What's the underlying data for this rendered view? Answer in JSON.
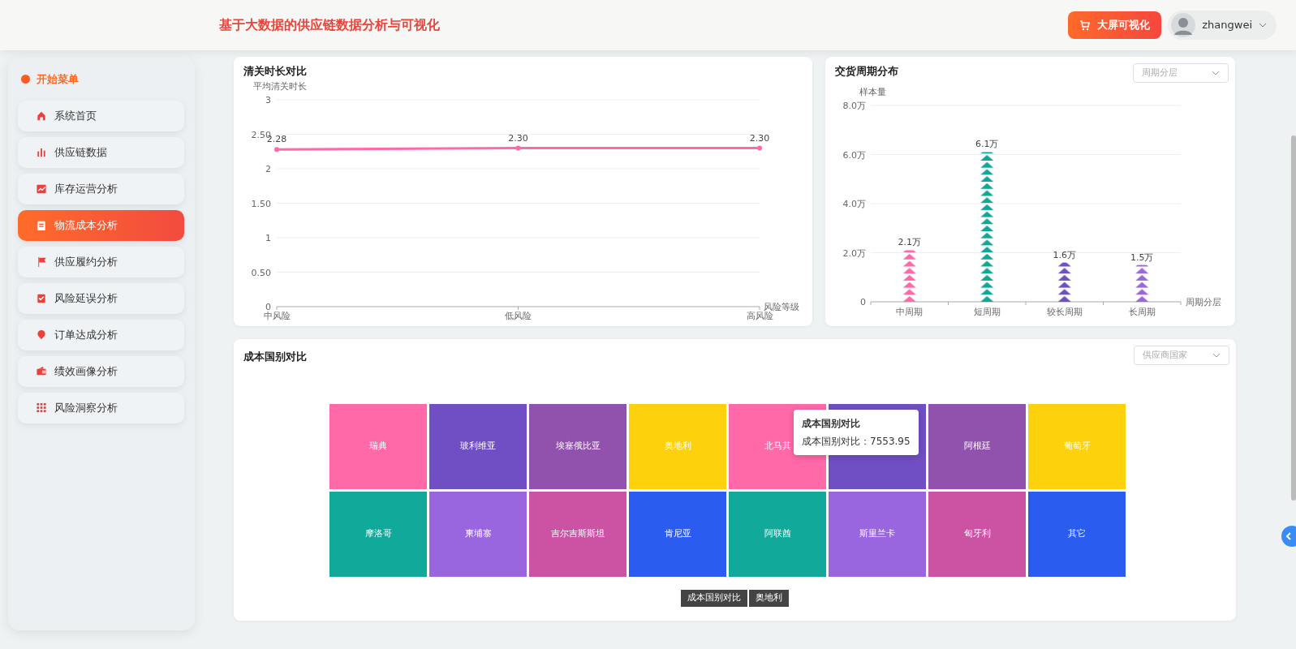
{
  "header": {
    "title": "基于大数据的供应链数据分析与可视化",
    "screen_button": "大屏可视化",
    "user": "zhangwei"
  },
  "sidebar": {
    "heading": "开始菜单",
    "items": [
      {
        "label": "系统首页",
        "selected": false
      },
      {
        "label": "供应链数据",
        "selected": false
      },
      {
        "label": "库存运营分析",
        "selected": false
      },
      {
        "label": "物流成本分析",
        "selected": true
      },
      {
        "label": "供应履约分析",
        "selected": false
      },
      {
        "label": "风险延误分析",
        "selected": false
      },
      {
        "label": "订单达成分析",
        "selected": false
      },
      {
        "label": "绩效画像分析",
        "selected": false
      },
      {
        "label": "风险洞察分析",
        "selected": false
      }
    ]
  },
  "clearance_card": {
    "title": "清关时长对比",
    "chart_data": {
      "type": "line",
      "ylabel": "平均清关时长",
      "xlabel": "风险等级",
      "categories": [
        "中风险",
        "低风险",
        "高风险"
      ],
      "grid": true,
      "series": [
        {
          "color": "#ff69a8",
          "marker": "circle",
          "values": [
            2.28,
            2.3,
            2.3
          ]
        }
      ],
      "value_labels": [
        "2.28",
        "2.30",
        "2.30"
      ],
      "ylim": [
        0,
        3
      ],
      "yticks": [
        {
          "value": 0,
          "label": "0"
        },
        {
          "value": 0.5,
          "label": "0.50"
        },
        {
          "value": 1,
          "label": "1"
        },
        {
          "value": 1.5,
          "label": "1.50"
        },
        {
          "value": 2,
          "label": "2"
        },
        {
          "value": 2.5,
          "label": "2.50"
        },
        {
          "value": 3,
          "label": "3"
        }
      ]
    }
  },
  "delivery_card": {
    "title": "交货周期分布",
    "dropdown": {
      "placeholder": "周期分层"
    },
    "chart_data": {
      "type": "bar",
      "ylabel": "样本量",
      "xlabel": "周期分层",
      "categories": [
        "中周期",
        "短周期",
        "较长周期",
        "长周期"
      ],
      "grid": true,
      "series": [
        {
          "values": [
            2.1,
            6.1,
            1.6,
            1.5
          ]
        }
      ],
      "colors": [
        "#ff69a8",
        "#11a797",
        "#6f4fc4",
        "#9966e0"
      ],
      "value_labels": [
        "2.1万",
        "6.1万",
        "1.6万",
        "1.5万"
      ],
      "ylim": [
        0,
        8
      ],
      "yticks": [
        {
          "value": 0,
          "label": "0"
        },
        {
          "value": 2,
          "label": "2.0万"
        },
        {
          "value": 4,
          "label": "4.0万"
        },
        {
          "value": 6,
          "label": "6.0万"
        },
        {
          "value": 8,
          "label": "8.0万"
        }
      ]
    }
  },
  "country_card": {
    "title": "成本国别对比",
    "dropdown": {
      "placeholder": "供应商国家"
    },
    "tiles": [
      {
        "label": "瑞典",
        "color": "#ff69a8"
      },
      {
        "label": "玻利维亚",
        "color": "#704fc4"
      },
      {
        "label": "埃塞俄比亚",
        "color": "#9152ad"
      },
      {
        "label": "奥地利",
        "color": "#fdd20d"
      },
      {
        "label": "北马其",
        "color": "#ff69a8"
      },
      {
        "color": "#704fc4"
      },
      {
        "label": "阿根廷",
        "color": "#9152ad"
      },
      {
        "label": "葡萄牙",
        "color": "#fdd20d"
      },
      {
        "label": "摩洛哥",
        "color": "#10a99a"
      },
      {
        "label": "柬埔寨",
        "color": "#9966e0"
      },
      {
        "label": "吉尔吉斯斯坦",
        "color": "#cc52a3"
      },
      {
        "label": "肯尼亚",
        "color": "#2b5cf0"
      },
      {
        "label": "阿联酋",
        "color": "#10a99a"
      },
      {
        "label": "斯里兰卡",
        "color": "#9966e0"
      },
      {
        "label": "匈牙利",
        "color": "#cc52a3"
      },
      {
        "label": "其它",
        "color": "#2b5cf0"
      }
    ],
    "tooltip": {
      "title": "成本国别对比",
      "text": "成本国别对比：7553.95"
    },
    "breadcrumb": [
      "成本国别对比",
      "奥地利"
    ]
  }
}
